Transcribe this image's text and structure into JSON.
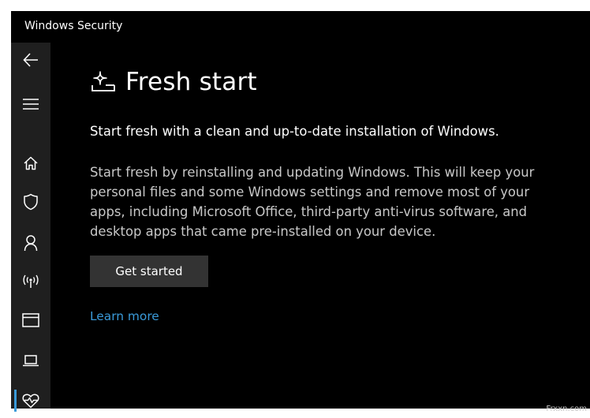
{
  "window": {
    "title": "Windows Security"
  },
  "sidebar": {
    "items": [
      {
        "name": "back",
        "icon": "back-arrow-icon"
      },
      {
        "name": "menu",
        "icon": "hamburger-menu-icon"
      },
      {
        "name": "home",
        "icon": "home-icon"
      },
      {
        "name": "virus-threat-protection",
        "icon": "shield-icon"
      },
      {
        "name": "account-protection",
        "icon": "person-icon"
      },
      {
        "name": "firewall-network-protection",
        "icon": "wireless-antenna-icon"
      },
      {
        "name": "app-browser-control",
        "icon": "browser-window-icon"
      },
      {
        "name": "device-security",
        "icon": "laptop-icon"
      },
      {
        "name": "device-performance-health",
        "icon": "heart-pulse-icon",
        "active": true
      }
    ],
    "accent_color": "#3a9ad9"
  },
  "main": {
    "title": "Fresh start",
    "title_icon": "fresh-start-icon",
    "subtitle": "Start fresh with a clean and up-to-date installation of Windows.",
    "description_lines": [
      "Start fresh by reinstalling and updating Windows. This will keep your",
      "personal files and some Windows settings and remove most of your",
      "apps, including Microsoft Office, third-party anti-virus software, and",
      "desktop apps that came pre-installed on your device."
    ],
    "get_started_label": "Get started",
    "learn_more_label": "Learn more",
    "link_color": "#3a9ad9"
  },
  "watermark": "Frxxn.com"
}
